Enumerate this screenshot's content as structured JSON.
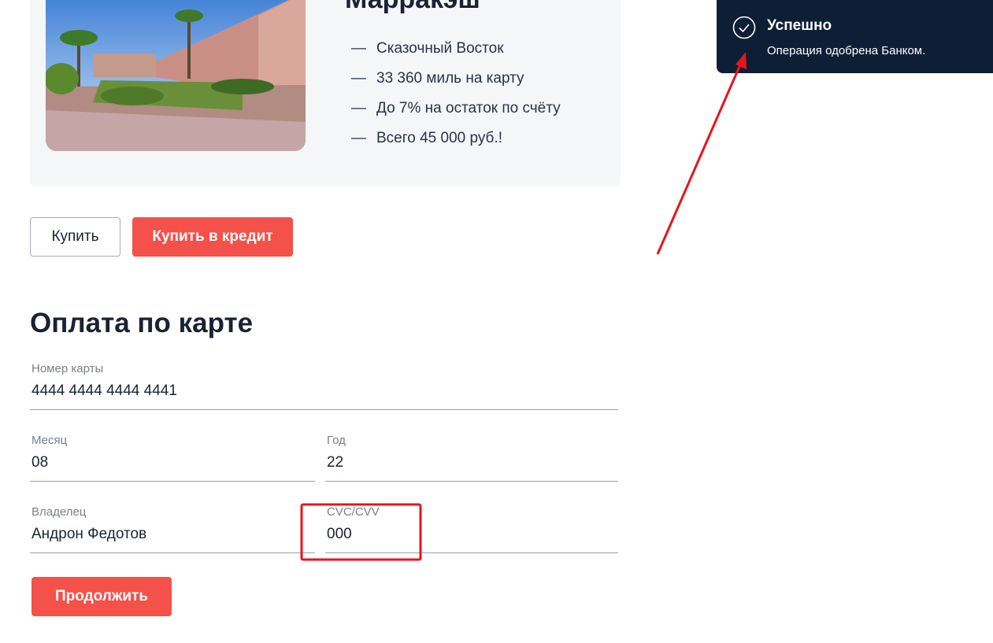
{
  "offer": {
    "city": "Марракэш",
    "features": [
      "Сказочный Восток",
      "33 360 миль на карту",
      "До 7% на остаток по счёту",
      "Всего 45 000 руб.!"
    ],
    "dash": "—"
  },
  "actions": {
    "buy_label": "Купить",
    "credit_label": "Купить в кредит"
  },
  "payment": {
    "title": "Оплата по карте",
    "card_number": {
      "label": "Номер карты",
      "value": "4444 4444 4444 4441"
    },
    "month": {
      "label": "Месяц",
      "value": "08"
    },
    "year": {
      "label": "Год",
      "value": "22"
    },
    "owner": {
      "label": "Владелец",
      "value": "Андрон Федотов"
    },
    "cvc": {
      "label": "CVC/CVV",
      "value": "000"
    },
    "continue_label": "Продолжить"
  },
  "notification": {
    "title": "Успешно",
    "message": "Операция одобрена Банком.",
    "icon": "check-circle-icon",
    "background": "#0e1f35"
  },
  "colors": {
    "accent": "#f35149",
    "annotation": "#e8141c"
  }
}
